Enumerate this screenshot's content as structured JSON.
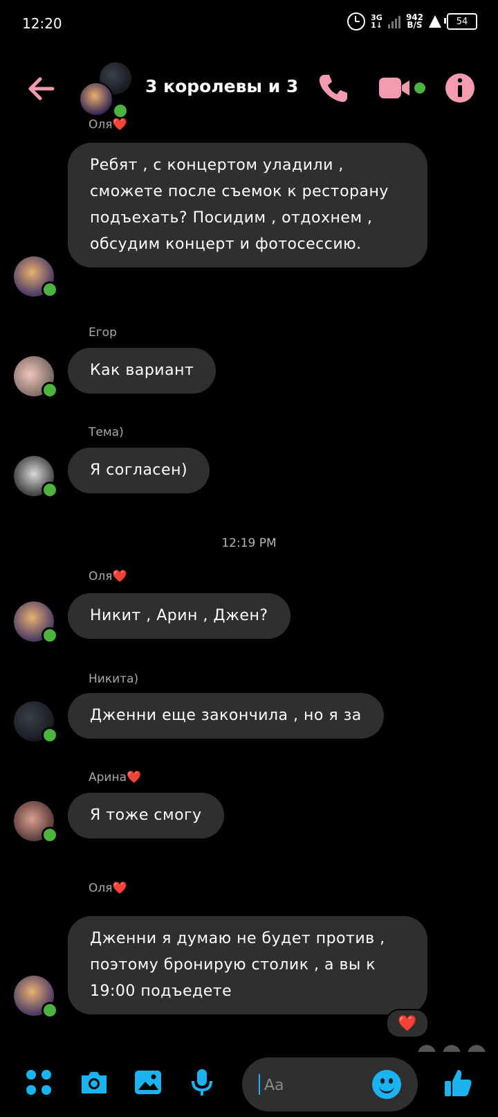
{
  "status_bar": {
    "time": "12:20",
    "network_top": "3G",
    "network_bottom": "1↓",
    "speed_top": "942",
    "speed_bottom": "B/S",
    "battery": "54"
  },
  "header": {
    "title": "3 королевы и 3"
  },
  "messages": [
    {
      "sender": "Оля",
      "heart": "❤️",
      "text": "Ребят , с концертом уладили , сможете после съемок к ресторану подъехать? Посидим , отдохнем , обсудим концерт и фотосессию."
    },
    {
      "sender": "Егор",
      "text": "Как вариант"
    },
    {
      "sender": "Тема)",
      "text": "Я согласен)"
    },
    {
      "sender": "Оля",
      "heart": "❤️",
      "text": "Никит , Арин , Джен?"
    },
    {
      "sender": "Никита)",
      "text": "Дженни еще закончила , но я за"
    },
    {
      "sender": "Арина",
      "heart": "❤️",
      "text": "Я тоже смогу"
    },
    {
      "sender": "Оля",
      "heart": "❤️",
      "text": "Дженни я думаю не будет против , поэтому бронирую столик , а вы к 19:00 подъедете",
      "reaction": "❤️"
    }
  ],
  "timestamp": "12:19 PM",
  "composer": {
    "placeholder": "Aa"
  },
  "colors": {
    "accent_pink": "#f59bb0",
    "accent_blue": "#1ab4f0",
    "bubble": "#2f2f2f",
    "online": "#4cb33e"
  },
  "icons": [
    "back-arrow-icon",
    "phone-icon",
    "video-icon",
    "info-icon",
    "apps-icon",
    "camera-icon",
    "gallery-icon",
    "microphone-icon",
    "emoji-icon",
    "thumbs-up-icon"
  ]
}
